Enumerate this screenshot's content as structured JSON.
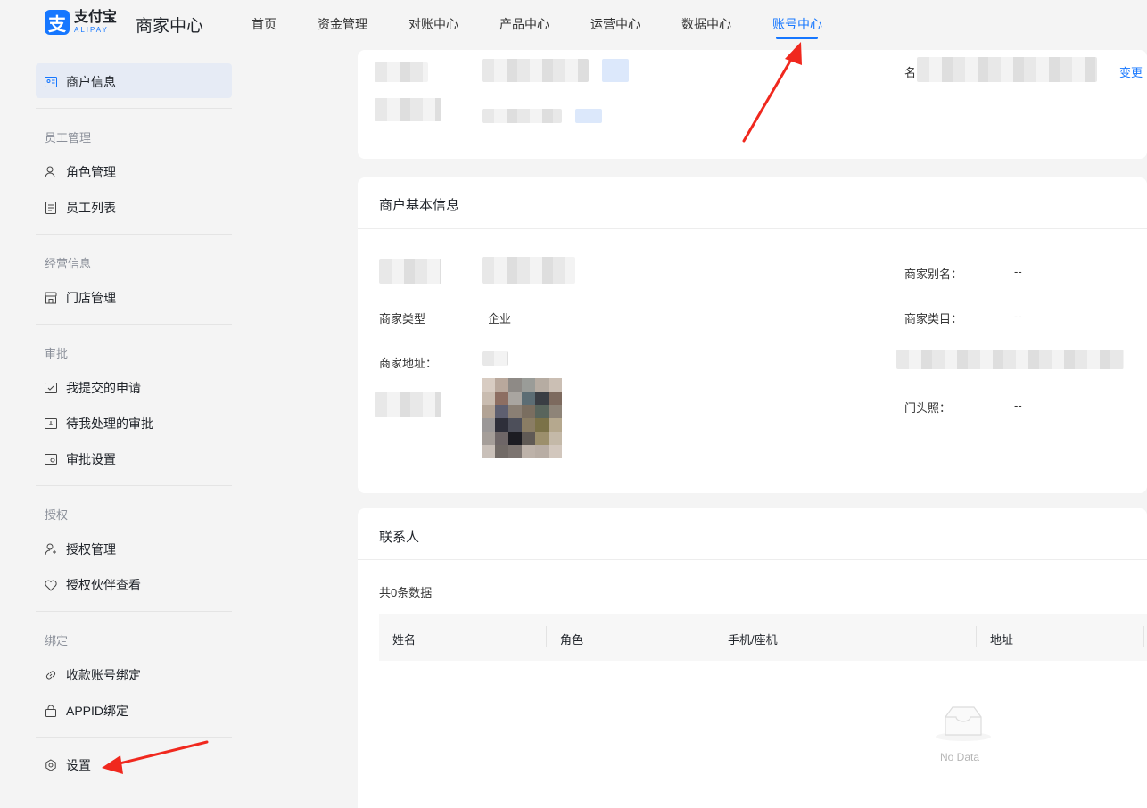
{
  "brand": {
    "logo_char": "支",
    "logo_cn": "支付宝",
    "logo_en": "ALIPAY",
    "app_title": "商家中心",
    "accent": "#1677ff"
  },
  "nav": {
    "items": [
      "首页",
      "资金管理",
      "对账中心",
      "产品中心",
      "运营中心",
      "数据中心",
      "账号中心"
    ],
    "active": "账号中心"
  },
  "sidebar": {
    "merchant_info": "商户信息",
    "groups": {
      "staff": "员工管理",
      "business": "经营信息",
      "approval": "审批",
      "auth": "授权",
      "binding": "绑定"
    },
    "items": {
      "role_mgmt": "角色管理",
      "staff_list": "员工列表",
      "store_mgmt": "门店管理",
      "my_requests": "我提交的申请",
      "pending_approvals": "待我处理的审批",
      "approval_settings": "审批设置",
      "auth_mgmt": "授权管理",
      "auth_partners": "授权伙伴查看",
      "payment_binding": "收款账号绑定",
      "appid_binding": "APPID绑定",
      "settings": "设置"
    }
  },
  "account_card": {
    "name_label": "名",
    "change_link": "变更"
  },
  "basic_info": {
    "title": "商户基本信息",
    "merchant_type_label": "商家类型",
    "merchant_type_value": "企业",
    "merchant_alias_label": "商家别名：",
    "merchant_alias_value": "--",
    "merchant_category_label": "商家类目：",
    "merchant_category_value": "--",
    "merchant_address_label": "商家地址：",
    "storefront_label": "门头照：",
    "storefront_value": "--"
  },
  "contacts": {
    "title": "联系人",
    "count_text": "共0条数据",
    "columns": [
      "姓名",
      "角色",
      "手机/座机",
      "地址"
    ],
    "empty_text": "No Data"
  }
}
